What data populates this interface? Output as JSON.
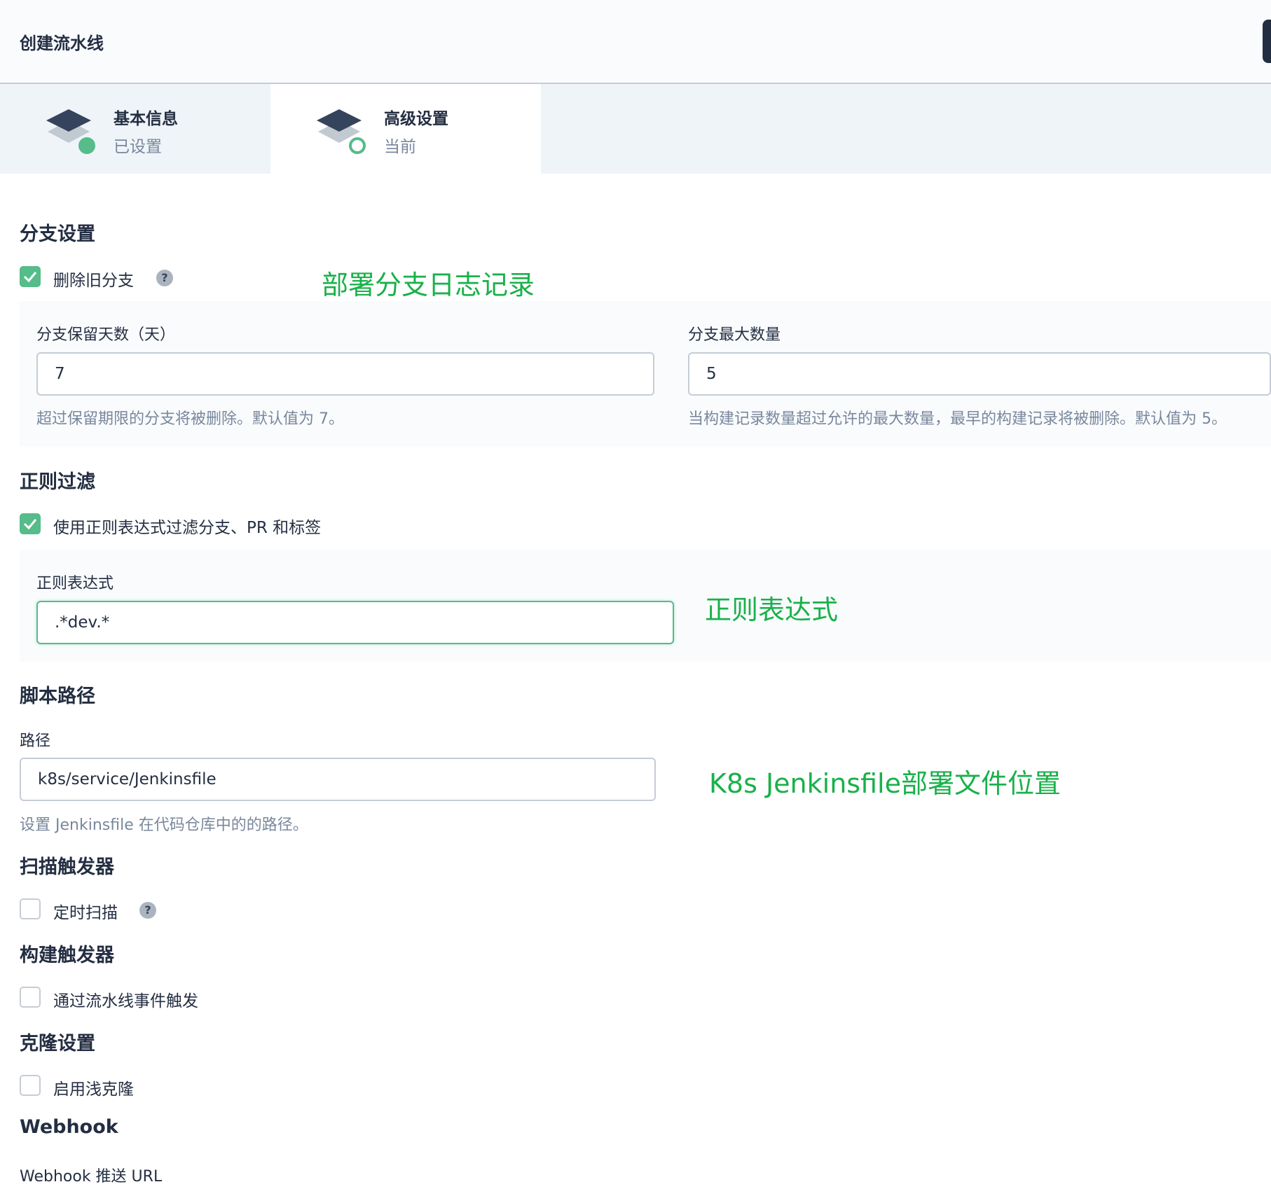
{
  "header": {
    "title": "创建流水线"
  },
  "steps": [
    {
      "title": "基本信息",
      "status": "已设置"
    },
    {
      "title": "高级设置",
      "status": "当前"
    }
  ],
  "branch": {
    "section_title": "分支设置",
    "delete_old_label": "删除旧分支",
    "help_glyph": "?",
    "days_label": "分支保留天数（天）",
    "days_value": "7",
    "days_hint": "超过保留期限的分支将被删除。默认值为 7。",
    "max_label": "分支最大数量",
    "max_value": "5",
    "max_hint": "当构建记录数量超过允许的最大数量，最早的构建记录将被删除。默认值为 5。"
  },
  "regex": {
    "section_title": "正则过滤",
    "checkbox_label": "使用正则表达式过滤分支、PR 和标签",
    "field_label": "正则表达式",
    "value": ".*dev.*"
  },
  "script": {
    "section_title": "脚本路径",
    "field_label": "路径",
    "value": "k8s/service/Jenkinsfile",
    "hint": "设置 Jenkinsfile 在代码仓库中的的路径。"
  },
  "scan": {
    "section_title": "扫描触发器",
    "checkbox_label": "定时扫描",
    "help_glyph": "?"
  },
  "build": {
    "section_title": "构建触发器",
    "checkbox_label": "通过流水线事件触发"
  },
  "clone": {
    "section_title": "克隆设置",
    "checkbox_label": "启用浅克隆"
  },
  "webhook": {
    "section_title": "Webhook",
    "field_label": "Webhook 推送 URL"
  },
  "annotations": {
    "branch_log": "部署分支日志记录",
    "regex": "正则表达式",
    "jenkinsfile": "K8s Jenkinsfile部署文件位置"
  },
  "colors": {
    "accent": "#55bc8a",
    "annotation": "#19b14a",
    "text": "#242e42",
    "muted": "#79879c"
  }
}
